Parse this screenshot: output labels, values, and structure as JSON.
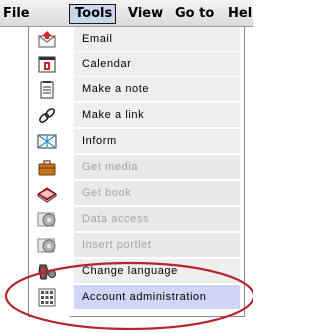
{
  "menubar": {
    "file": "File",
    "tools": "Tools",
    "view": "View",
    "goto": "Go to",
    "help": "Hel"
  },
  "tools_menu": {
    "items": [
      {
        "label": "Email",
        "icon": "email-icon",
        "enabled": true
      },
      {
        "label": "Calendar",
        "icon": "calendar-icon",
        "enabled": true
      },
      {
        "label": "Make a note",
        "icon": "note-icon",
        "enabled": true
      },
      {
        "label": "Make a link",
        "icon": "link-icon",
        "enabled": true
      },
      {
        "label": "Inform",
        "icon": "inform-icon",
        "enabled": true
      },
      {
        "label": "Get media",
        "icon": "briefcase-icon",
        "enabled": false
      },
      {
        "label": "Get book",
        "icon": "book-icon",
        "enabled": false
      },
      {
        "label": "Data access",
        "icon": "data-access-icon",
        "enabled": false
      },
      {
        "label": "Insert portlet",
        "icon": "portlet-icon",
        "enabled": false
      },
      {
        "label": "Change language",
        "icon": "language-icon",
        "enabled": true
      },
      {
        "label": "Account administration",
        "icon": "account-admin-icon",
        "enabled": true,
        "highlighted": true
      }
    ]
  },
  "colors": {
    "highlight": "#d2d6f6",
    "annotation_ellipse": "#b5252c",
    "disabled_text": "#a4a4a4"
  }
}
